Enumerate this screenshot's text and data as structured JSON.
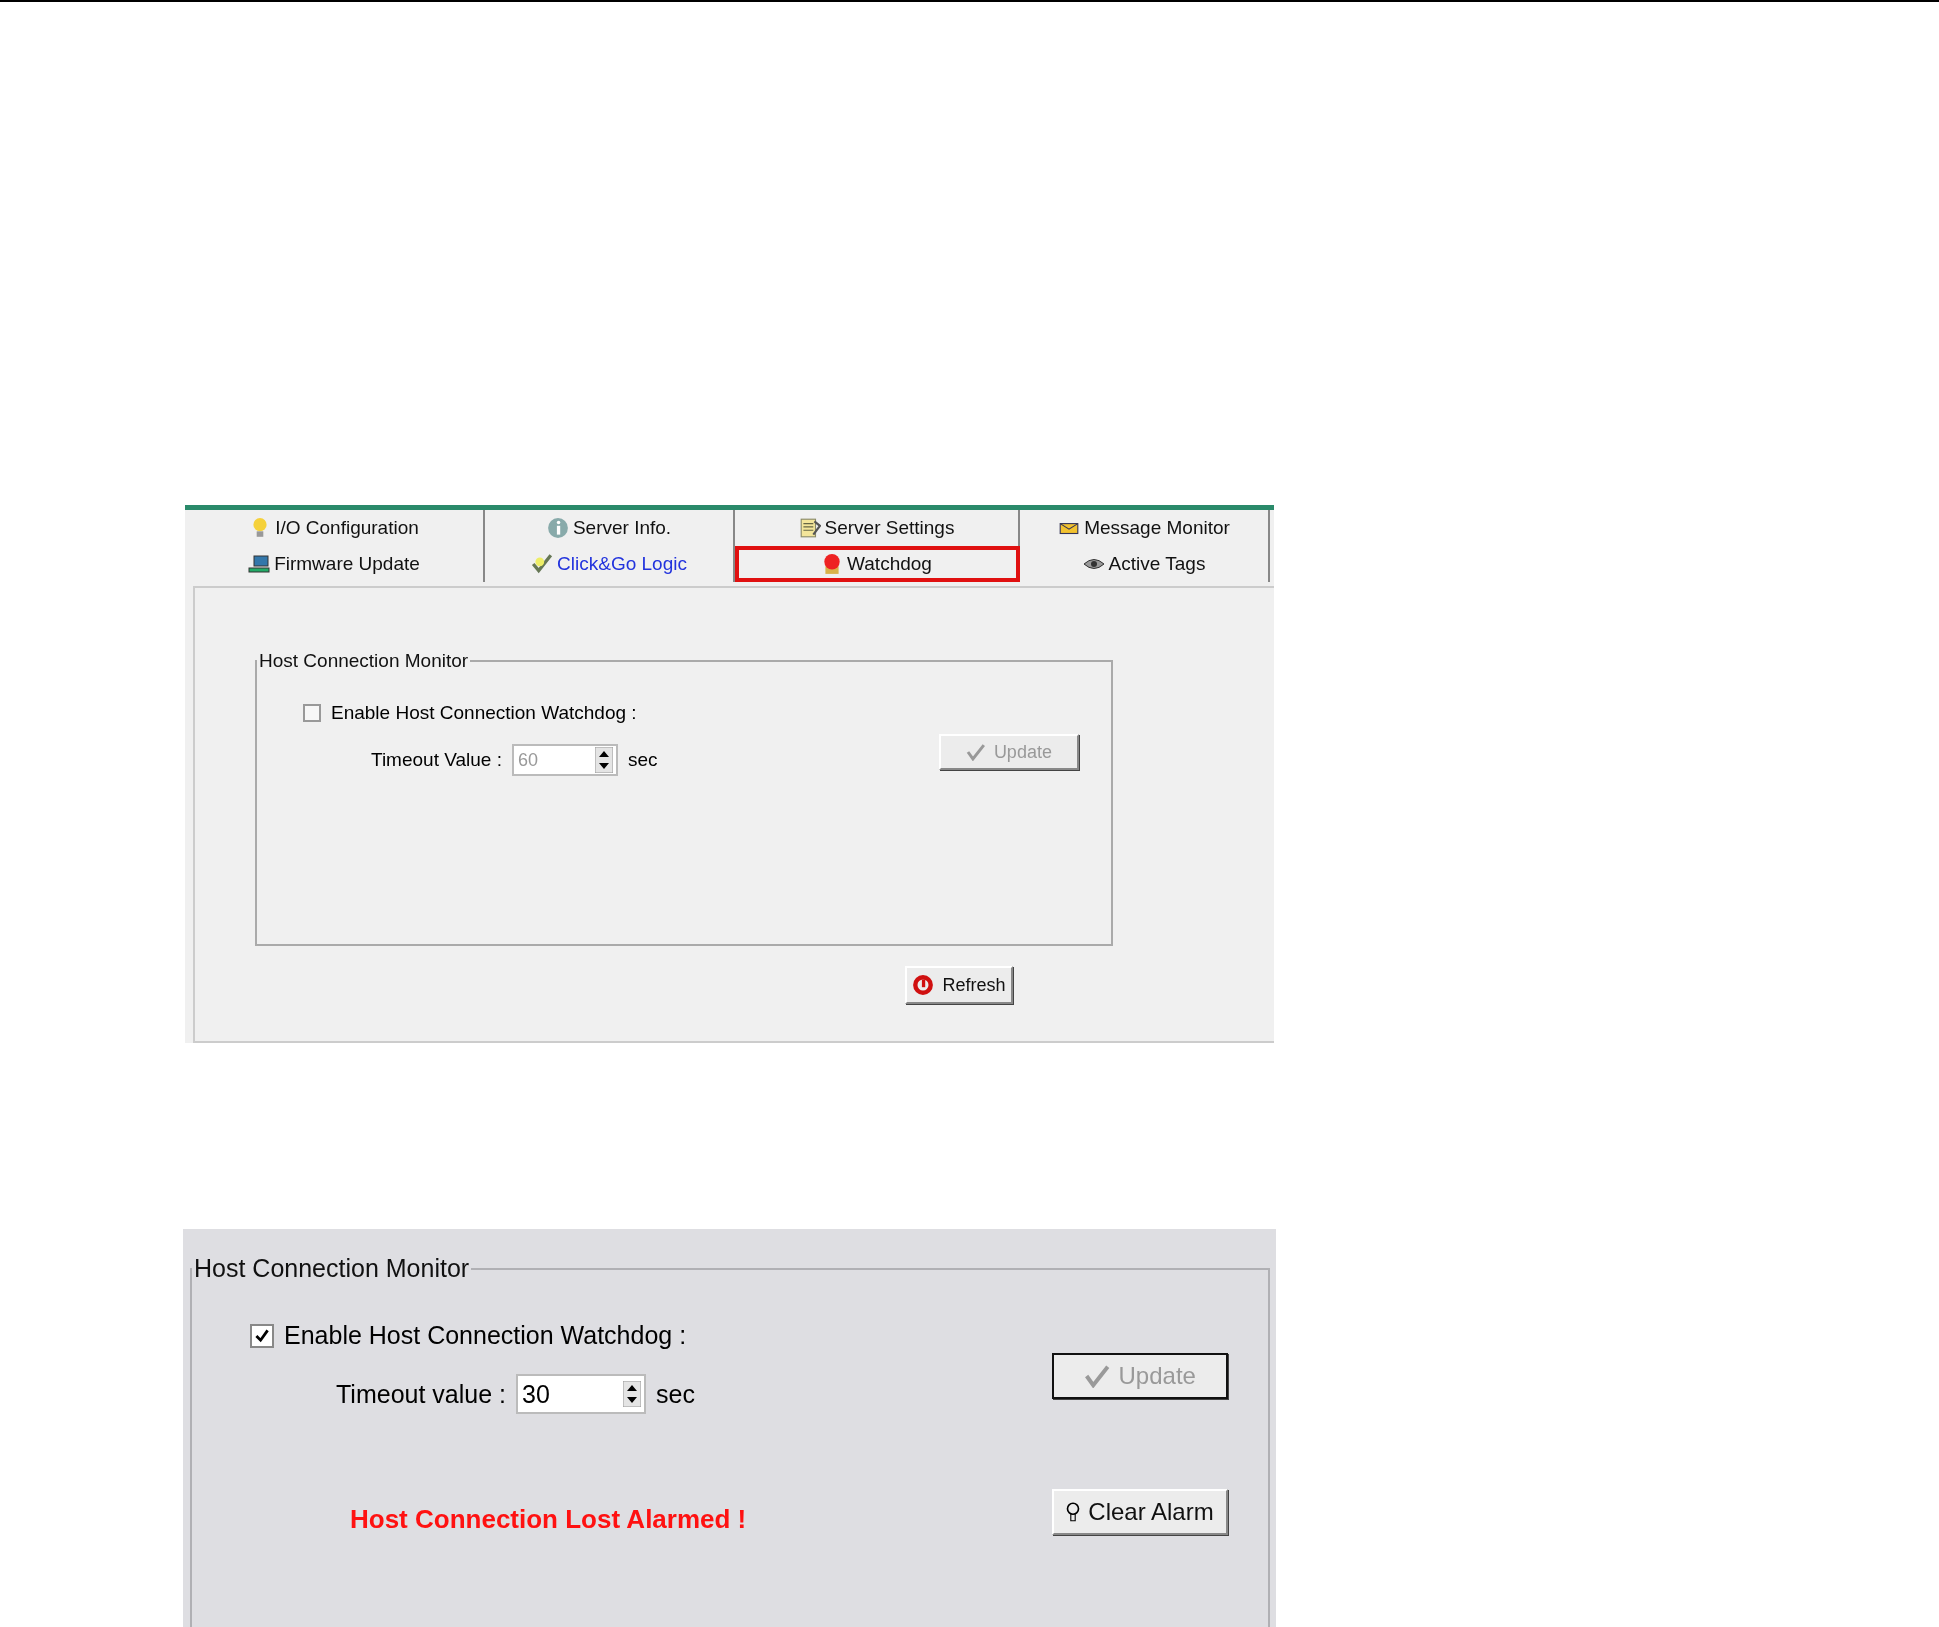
{
  "tab_rows": [
    [
      {
        "label": "I/O Configuration",
        "selected": false,
        "hot": false
      },
      {
        "label": "Server Info.",
        "selected": false,
        "hot": false
      },
      {
        "label": "Server Settings",
        "selected": false,
        "hot": false
      },
      {
        "label": "Message Monitor",
        "selected": false,
        "hot": false
      }
    ],
    [
      {
        "label": "Firmware Update",
        "selected": false,
        "hot": false
      },
      {
        "label": "Click&Go Logic",
        "selected": false,
        "hot": true
      },
      {
        "label": "Watchdog",
        "selected": true,
        "hot": false
      },
      {
        "label": "Active Tags",
        "selected": false,
        "hot": false
      }
    ]
  ],
  "watchdog_panel": {
    "title": "Host Connection Monitor",
    "enable_label": "Enable Host Connection Watchdog :",
    "enabled": false,
    "timeout_label": "Timeout Value :",
    "timeout_value": "60",
    "timeout_disabled": true,
    "unit": "sec",
    "update_button": {
      "label": "Update",
      "disabled": true
    },
    "refresh_button": "Refresh"
  },
  "alarm_panel": {
    "title": "Host Connection Monitor",
    "enable_label": "Enable Host Connection Watchdog :",
    "enabled": true,
    "timeout_label": "Timeout value :",
    "timeout_value": "30",
    "timeout_disabled": false,
    "unit": "sec",
    "update_button": {
      "label": "Update",
      "disabled": true
    },
    "alarm_message": "Host Connection Lost Alarmed !",
    "clear_alarm_button": "Clear Alarm"
  }
}
